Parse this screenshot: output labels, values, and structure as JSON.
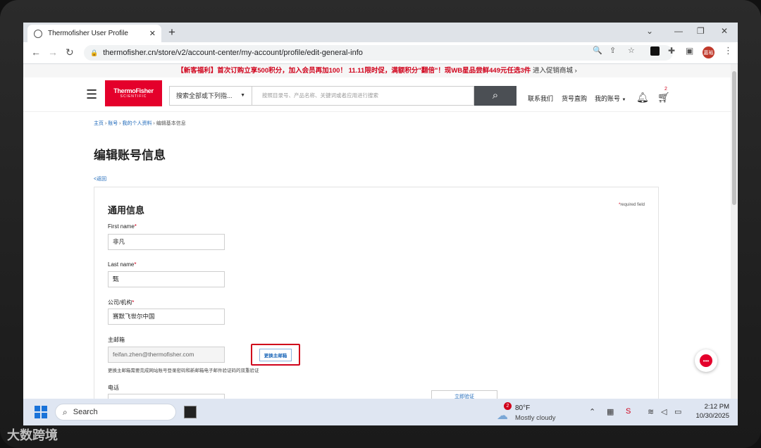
{
  "browser": {
    "tab_title": "Thermofisher User Profile",
    "tab_close": "✕",
    "new_tab": "+",
    "url": "thermofisher.cn/store/v2/account-center/my-account/profile/edit-general-info",
    "profile_initials": "嘉裕"
  },
  "promo": {
    "text": "【新客福利】首次订购立享500积分，加入会员再加100！ 11.11限时促，满额积分\"翻倍\"！现WB星品尝鲜449元任选3件",
    "link": "进入促销商城 ›"
  },
  "header": {
    "logo_line1": "ThermoFisher",
    "logo_line2": "SCIENTIFIC",
    "search_select": "搜索全部或下列指...",
    "search_placeholder": "按照目录号、产品名称、关键词或者应用进行搜索",
    "contact": "联系我们",
    "quick_order": "货号直购",
    "my_account": "我的账号",
    "cart_count": "2"
  },
  "breadcrumb": {
    "home": "主页",
    "account": "账号",
    "profile": "我的个人资料",
    "current": "编辑基本信息"
  },
  "page": {
    "title": "编辑账号信息",
    "back": "<返回"
  },
  "form": {
    "section_title": "通用信息",
    "required_note": "required field",
    "first_name_label": "First name",
    "first_name_value": "非凡",
    "last_name_label": "Last name",
    "last_name_value": "甄",
    "company_label": "公司/机构",
    "company_value": "赛默飞世尔中国",
    "email_label": "主邮箱",
    "email_value": "feifan.zhen@thermofisher.com",
    "change_email_button": "更换主邮箱",
    "email_hint": "更换主邮箱需要完成网站账号登录密码和新邮箱电子邮件验证码的双重验证",
    "phone_label": "电话",
    "verify_button": "立即验证"
  },
  "taskbar": {
    "search": "Search",
    "weather_badge": "2",
    "temperature": "80°F",
    "condition": "Mostly cloudy",
    "time": "2:12 PM",
    "date": "10/30/2025"
  },
  "watermark": "大数跨境"
}
